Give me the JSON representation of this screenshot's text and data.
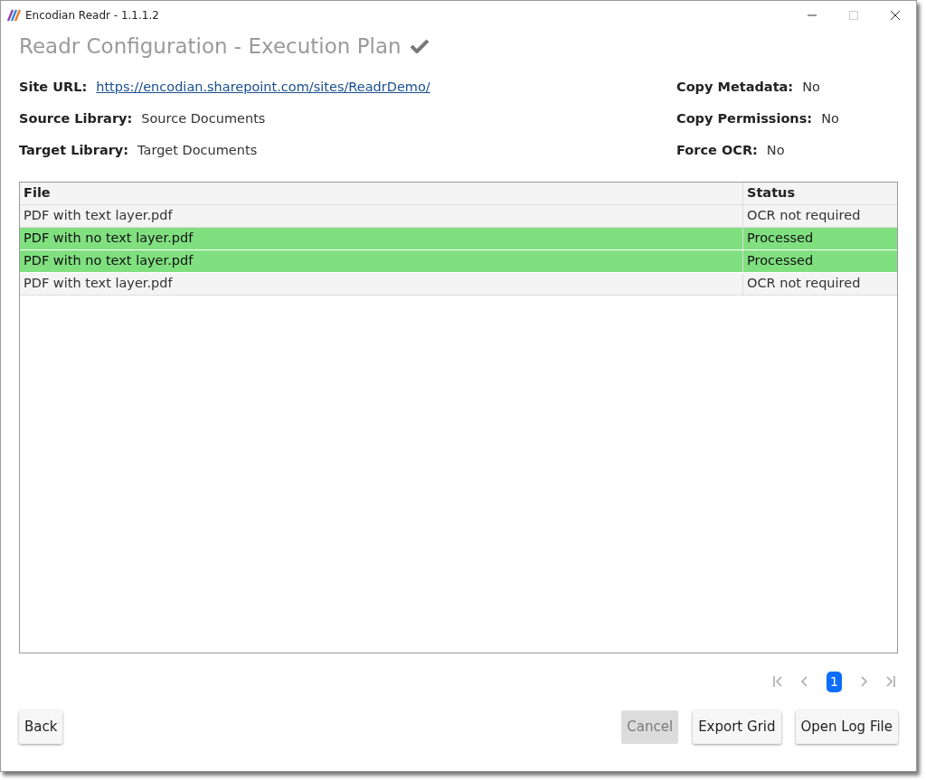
{
  "window": {
    "title": "Encodian Readr - 1.1.1.2"
  },
  "heading": {
    "text": "Readr Configuration - Execution Plan",
    "complete": true
  },
  "details_left": [
    {
      "label": "Site URL:",
      "value": "https://encodian.sharepoint.com/sites/ReadrDemo/",
      "link": true
    },
    {
      "label": "Source Library:",
      "value": "Source Documents",
      "link": false
    },
    {
      "label": "Target Library:",
      "value": "Target Documents",
      "link": false
    }
  ],
  "details_right": [
    {
      "label": "Copy Metadata:",
      "value": "No"
    },
    {
      "label": "Copy Permissions:",
      "value": "No"
    },
    {
      "label": "Force OCR:",
      "value": "No"
    }
  ],
  "table": {
    "columns": [
      "File",
      "Status"
    ],
    "rows": [
      {
        "file": "PDF with text layer.pdf",
        "status": "OCR not required",
        "highlighted": false
      },
      {
        "file": "PDF with no text layer.pdf",
        "status": "Processed",
        "highlighted": true
      },
      {
        "file": "PDF with no text layer.pdf",
        "status": "Processed",
        "highlighted": true
      },
      {
        "file": "PDF with text layer.pdf",
        "status": "OCR not required",
        "highlighted": false
      }
    ]
  },
  "pager": {
    "pages": [
      {
        "label": "1",
        "selected": true
      }
    ]
  },
  "buttons_left": [
    {
      "label": "Back",
      "disabled": false
    }
  ],
  "buttons_right": [
    {
      "label": "Cancel",
      "disabled": true
    },
    {
      "label": "Export Grid",
      "disabled": false
    },
    {
      "label": "Open Log File",
      "disabled": false
    }
  ]
}
